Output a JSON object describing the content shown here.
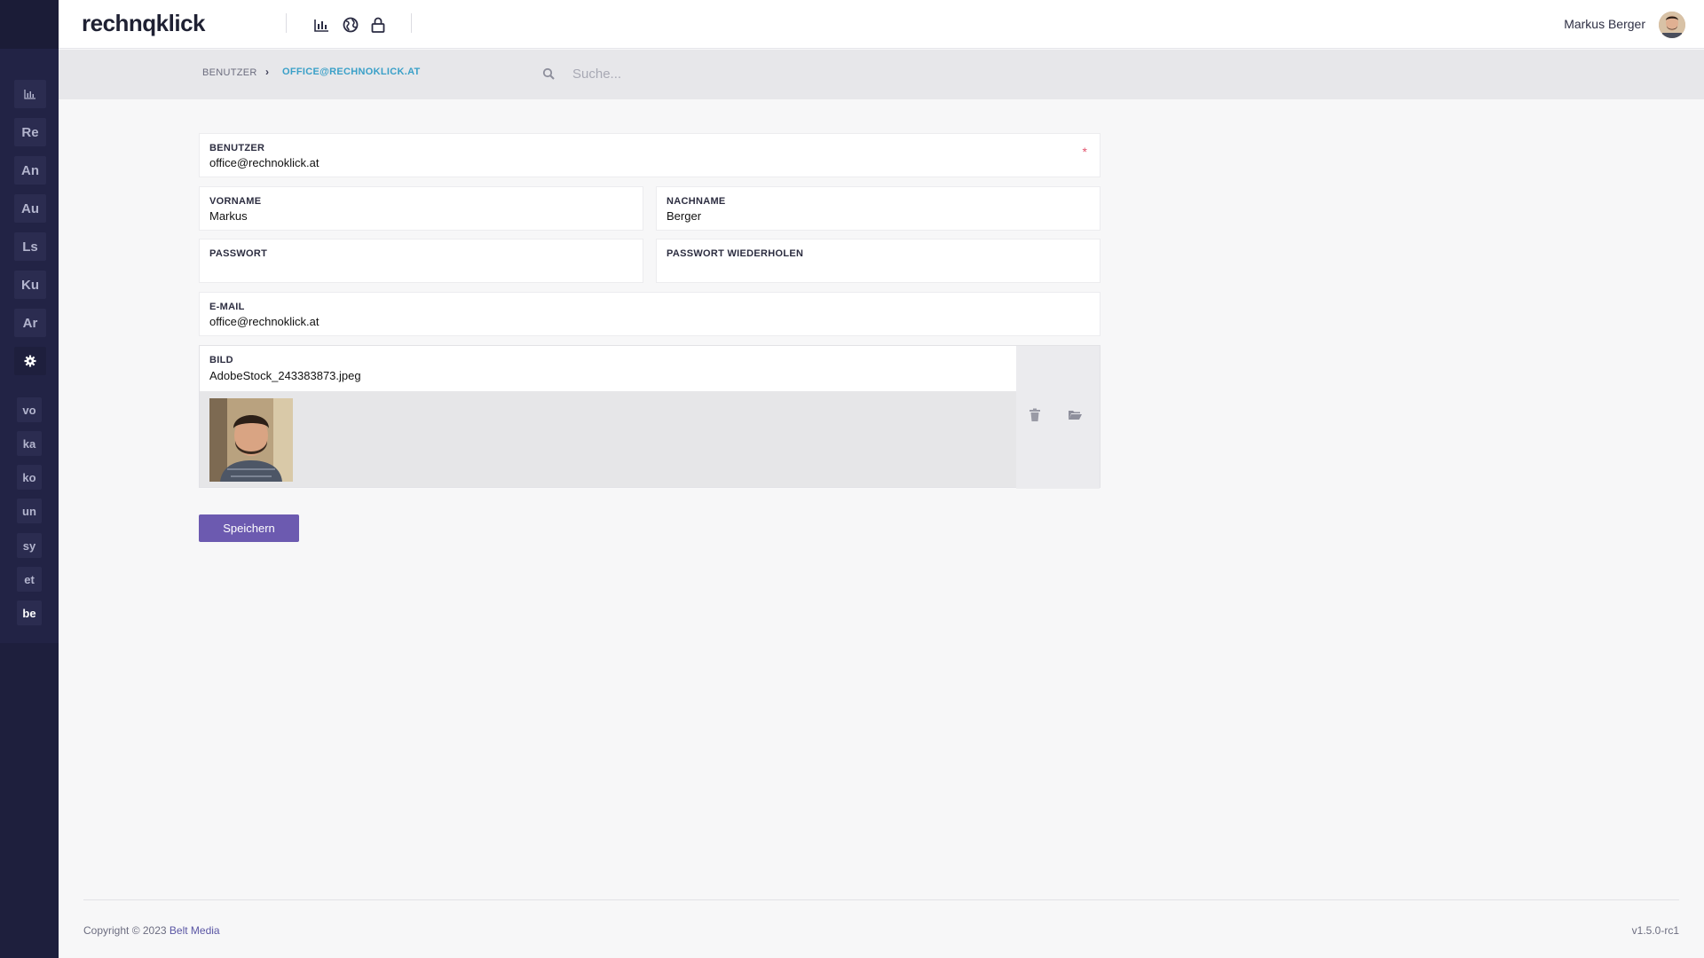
{
  "app": {
    "logo": "rechnqklick",
    "user_name": "Markus Berger"
  },
  "sidebar": {
    "items": [
      {
        "label": "",
        "icon": "bar-chart-icon"
      },
      {
        "label": "Re"
      },
      {
        "label": "An"
      },
      {
        "label": "Au"
      },
      {
        "label": "Ls"
      },
      {
        "label": "Ku"
      },
      {
        "label": "Ar"
      },
      {
        "label": "",
        "icon": "gear-icon"
      },
      {
        "label": "vo"
      },
      {
        "label": "ka"
      },
      {
        "label": "ko"
      },
      {
        "label": "un"
      },
      {
        "label": "sy"
      },
      {
        "label": "et"
      },
      {
        "label": "be"
      }
    ]
  },
  "header": {
    "icons": [
      "bar-chart-icon",
      "globe-icon",
      "lock-icon"
    ]
  },
  "breadcrumb": {
    "parent": "BENUTZER",
    "current": "OFFICE@RECHNOKLICK.AT"
  },
  "search": {
    "placeholder": "Suche..."
  },
  "form": {
    "benutzer": {
      "label": "BENUTZER",
      "value": "office@rechnoklick.at",
      "required": "*"
    },
    "vorname": {
      "label": "VORNAME",
      "value": "Markus"
    },
    "nachname": {
      "label": "NACHNAME",
      "value": "Berger"
    },
    "passwort": {
      "label": "PASSWORT",
      "value": ""
    },
    "passwort_wiederholen": {
      "label": "PASSWORT WIEDERHOLEN",
      "value": ""
    },
    "email": {
      "label": "E-MAIL",
      "value": "office@rechnoklick.at"
    },
    "bild": {
      "label": "BILD",
      "value": "AdobeStock_243383873.jpeg"
    },
    "save_label": "Speichern"
  },
  "footer": {
    "copyright": "Copyright © 2023",
    "company": "Belt Media",
    "version": "v1.5.0-rc1"
  },
  "colors": {
    "sidebar": "#1e1f3d",
    "accent": "#6c5ab0",
    "breadcrumb_active": "#3aa0c8",
    "required": "#e2546e"
  }
}
